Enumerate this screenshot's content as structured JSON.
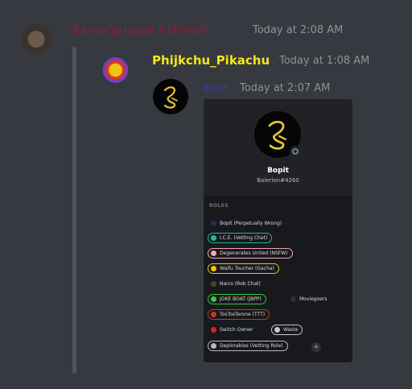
{
  "outer_message": {
    "author": "Kampfgruppe Kafewalt",
    "timestamp": "Today at 2:08 AM"
  },
  "quoted_message": {
    "author": "Phijkchu_Pikachu",
    "timestamp": "Today at 1:08 AM"
  },
  "inner_message": {
    "author": "Bopit",
    "timestamp": "Today at 2:07 AM"
  },
  "profile": {
    "name": "Bopit",
    "tag": "Balerion#4260",
    "roles_heading": "ROLES",
    "status": "offline",
    "roles": [
      {
        "label": "Bopit (Perpetually Wrong)",
        "color": "#2a2560"
      },
      {
        "label": "I.C.E. (Vetting Chat)",
        "color": "#1abc9c"
      },
      {
        "label": "Degenerates United (NSFW)",
        "color": "#f4a6b5"
      },
      {
        "label": "Waifu Toucher (Gacha)",
        "color": "#f1c40f"
      },
      {
        "label": "Narcs (Rob Chat)",
        "color": "#5a3a2a"
      },
      {
        "label": "JOKE BOAT (JBPP)",
        "color": "#2ecc40"
      },
      {
        "label": "Moviegoers",
        "color": "#2f3136"
      },
      {
        "label": "TosTosTerone (TTT)",
        "color": "#c0392b"
      },
      {
        "label": "Switch Owner",
        "color": "#e02020"
      },
      {
        "label": "Waste",
        "color": "#c8c8c8"
      },
      {
        "label": "Deplorables (Vetting Role)",
        "color": "#b9bbbe"
      }
    ]
  },
  "colors": {
    "background": "#36393f",
    "popout": "#18191c",
    "timestamp": "#8e9297",
    "pikachu_name": "#f5e51a",
    "kafewalt_name": "#8b1f3a"
  }
}
